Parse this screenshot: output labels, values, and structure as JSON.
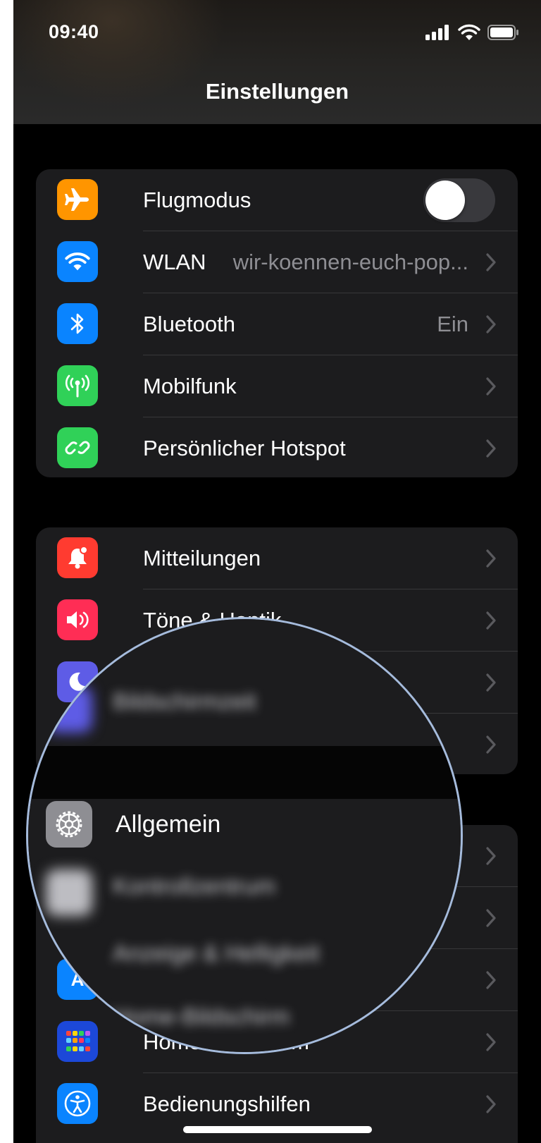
{
  "status_bar": {
    "time": "09:40"
  },
  "nav": {
    "title": "Einstellungen"
  },
  "group1": [
    {
      "label": "Flugmodus",
      "icon": "airplane-icon",
      "color": "#ff9500",
      "toggle": false
    },
    {
      "label": "WLAN",
      "value": "wir-koennen-euch-pop...",
      "icon": "wifi-icon",
      "color": "#0a84ff"
    },
    {
      "label": "Bluetooth",
      "value": "Ein",
      "icon": "bluetooth-icon",
      "color": "#0a84ff"
    },
    {
      "label": "Mobilfunk",
      "icon": "antenna-icon",
      "color": "#30d158"
    },
    {
      "label": "Persönlicher Hotspot",
      "icon": "hotspot-icon",
      "color": "#30d158"
    }
  ],
  "group2": [
    {
      "label": "Mitteilungen",
      "icon": "notification-bell-icon",
      "color": "#ff3b30"
    },
    {
      "label": "Töne & Haptik",
      "icon": "speaker-icon",
      "color": "#ff2d55"
    },
    {
      "label": "Bildschirmzeit",
      "icon": "moon-icon",
      "color": "#5e5ce6"
    },
    {
      "label": "",
      "icon": "",
      "color": ""
    }
  ],
  "group3": [
    {
      "label": "Allgemein",
      "icon": "gear-icon",
      "color": "#8e8e93"
    },
    {
      "label": "Kontrollzentrum",
      "icon": "control-center-icon",
      "color": "#8e8e93"
    },
    {
      "label": "Anzeige & Helligkeit",
      "icon": "display-icon",
      "color": "#0a84ff"
    },
    {
      "label": "Home-Bildschirm",
      "icon": "home-screen-icon",
      "color": "#0a84ff"
    },
    {
      "label": "Bedienungshilfen",
      "icon": "accessibility-icon",
      "color": "#0a84ff"
    }
  ],
  "magnifier": {
    "focus_label": "Allgemein",
    "blurred_above": "Bildschirmzeit",
    "blurred_below_1": "Kontrollzentrum",
    "blurred_below_2": "Anzeige & Helligkeit",
    "blurred_below_3": "Home-Bildschirm"
  }
}
